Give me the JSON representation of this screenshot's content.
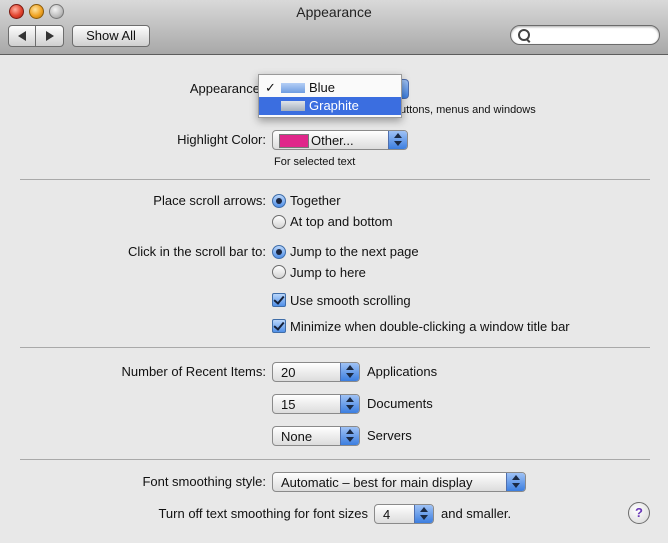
{
  "window": {
    "title": "Appearance"
  },
  "toolbar": {
    "show_all": "Show All",
    "search_placeholder": ""
  },
  "appearance": {
    "label": "Appearance",
    "menu_items": [
      {
        "label": "Blue",
        "checked": true,
        "check": "✓",
        "color": "#7aa6e6"
      },
      {
        "label": "Graphite",
        "checked": false,
        "check": "",
        "color": "#b9c2cf"
      }
    ],
    "note": "uttons, menus and windows"
  },
  "highlight": {
    "label": "Highlight Color:",
    "value": "Other...",
    "swatch_color": "#e0268a",
    "note": "For selected text"
  },
  "scroll_arrows": {
    "label": "Place scroll arrows:",
    "options": [
      "Together",
      "At top and bottom"
    ],
    "selected": 0
  },
  "scroll_click": {
    "label": "Click in the scroll bar to:",
    "options": [
      "Jump to the next page",
      "Jump to here"
    ],
    "selected": 0
  },
  "checkboxes": [
    {
      "label": "Use smooth scrolling",
      "checked": true
    },
    {
      "label": "Minimize when double-clicking a window title bar",
      "checked": true
    }
  ],
  "recent": {
    "label": "Number of Recent Items:",
    "rows": [
      {
        "value": "20",
        "kind": "Applications"
      },
      {
        "value": "15",
        "kind": "Documents"
      },
      {
        "value": "None",
        "kind": "Servers"
      }
    ]
  },
  "font_smoothing": {
    "label": "Font smoothing style:",
    "value": "Automatic – best for main display"
  },
  "text_smoothing": {
    "label": "Turn off text smoothing for font sizes",
    "value": "4",
    "suffix": "and smaller."
  },
  "help": {
    "glyph": "?"
  }
}
